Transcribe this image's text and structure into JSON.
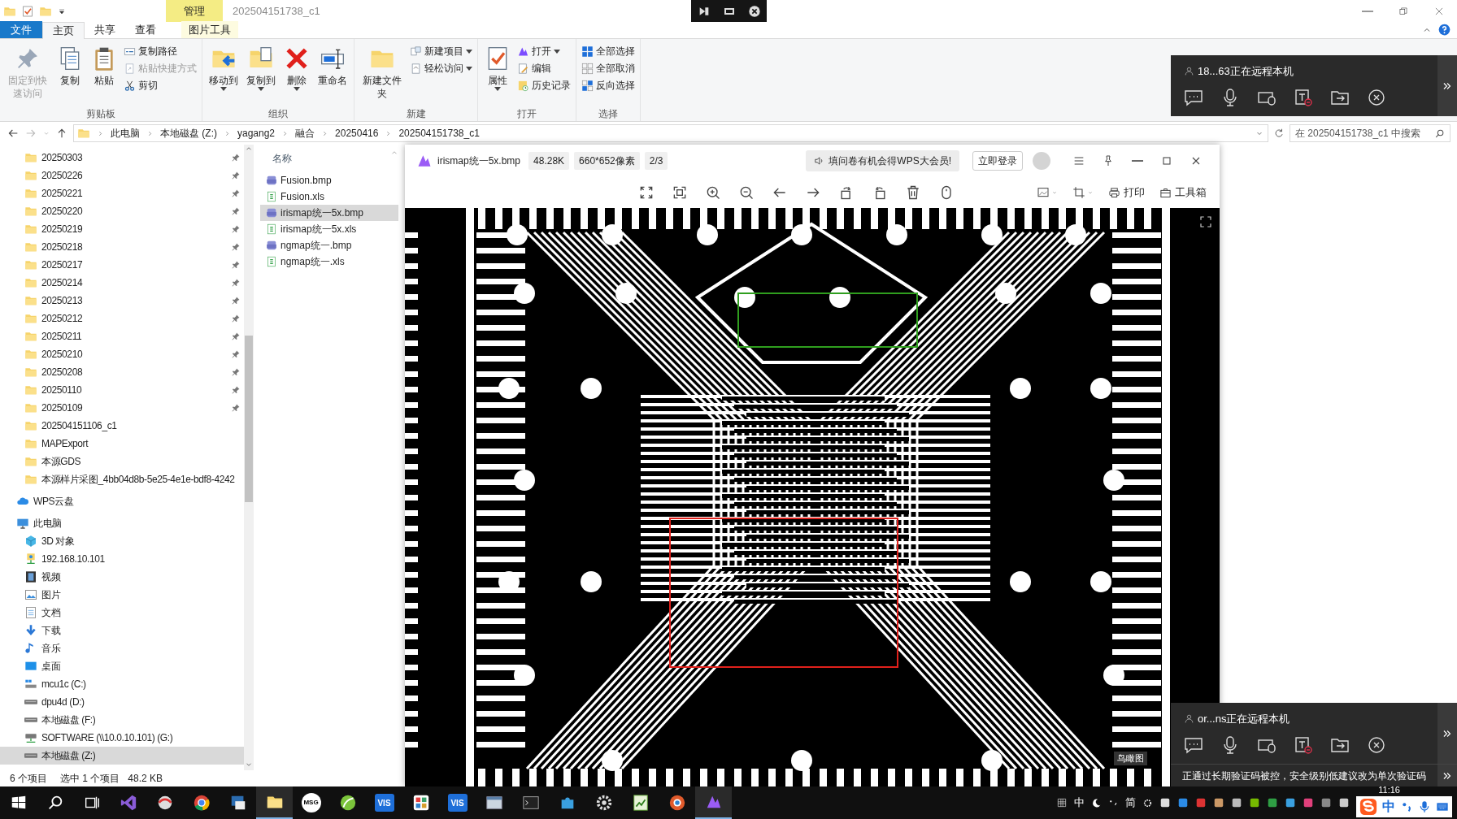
{
  "window": {
    "title": "202504151738_c1",
    "context_group": "管理"
  },
  "ribbon_tabs": [
    {
      "label": "文件",
      "kind": "file",
      "selected": false
    },
    {
      "label": "主页",
      "kind": "tab",
      "selected": true
    },
    {
      "label": "共享",
      "kind": "tab",
      "selected": false
    },
    {
      "label": "查看",
      "kind": "tab",
      "selected": false
    },
    {
      "label": "图片工具",
      "kind": "context",
      "selected": false
    }
  ],
  "ribbon_groups": [
    {
      "label": "剪贴板",
      "items": [
        {
          "kind": "large",
          "label": "固定到快速访问",
          "disabled": true,
          "dropdown": false
        },
        {
          "kind": "large",
          "label": "复制",
          "disabled": false,
          "dropdown": false
        },
        {
          "kind": "large",
          "label": "粘贴",
          "disabled": false,
          "dropdown": false
        },
        {
          "kind": "small",
          "label": "复制路径",
          "disabled": false,
          "dropdown": false
        },
        {
          "kind": "small",
          "label": "粘贴快捷方式",
          "disabled": true,
          "dropdown": false
        },
        {
          "kind": "small",
          "label": "剪切",
          "disabled": false,
          "dropdown": false
        }
      ]
    },
    {
      "label": "组织",
      "items": [
        {
          "kind": "large",
          "label": "移动到",
          "disabled": false,
          "dropdown": true
        },
        {
          "kind": "large",
          "label": "复制到",
          "disabled": false,
          "dropdown": true
        },
        {
          "kind": "large",
          "label": "删除",
          "disabled": false,
          "dropdown": true
        },
        {
          "kind": "large",
          "label": "重命名",
          "disabled": false,
          "dropdown": false
        }
      ]
    },
    {
      "label": "新建",
      "items": [
        {
          "kind": "large",
          "label": "新建文件夹",
          "disabled": false,
          "dropdown": false
        },
        {
          "kind": "small",
          "label": "新建项目",
          "disabled": false,
          "dropdown": true
        },
        {
          "kind": "small",
          "label": "轻松访问",
          "disabled": false,
          "dropdown": true
        }
      ]
    },
    {
      "label": "打开",
      "items": [
        {
          "kind": "large",
          "label": "属性",
          "disabled": false,
          "dropdown": true
        },
        {
          "kind": "small",
          "label": "打开",
          "disabled": false,
          "dropdown": true
        },
        {
          "kind": "small",
          "label": "编辑",
          "disabled": false,
          "dropdown": false
        },
        {
          "kind": "small",
          "label": "历史记录",
          "disabled": false,
          "dropdown": false
        }
      ]
    },
    {
      "label": "选择",
      "items": [
        {
          "kind": "small",
          "label": "全部选择",
          "disabled": false,
          "dropdown": false
        },
        {
          "kind": "small",
          "label": "全部取消",
          "disabled": false,
          "dropdown": false
        },
        {
          "kind": "small",
          "label": "反向选择",
          "disabled": false,
          "dropdown": false
        }
      ]
    }
  ],
  "address": {
    "path": [
      "此电脑",
      "本地磁盘 (Z:)",
      "yagang2",
      "融合",
      "20250416",
      "202504151738_c1"
    ],
    "search_placeholder": "在 202504151738_c1 中搜索"
  },
  "navigation": [
    {
      "label": "20250303",
      "kind": "folder",
      "pinned": true,
      "selected": false
    },
    {
      "label": "20250226",
      "kind": "folder",
      "pinned": true,
      "selected": false
    },
    {
      "label": "20250221",
      "kind": "folder",
      "pinned": true,
      "selected": false
    },
    {
      "label": "20250220",
      "kind": "folder",
      "pinned": true,
      "selected": false
    },
    {
      "label": "20250219",
      "kind": "folder",
      "pinned": true,
      "selected": false
    },
    {
      "label": "20250218",
      "kind": "folder",
      "pinned": true,
      "selected": false
    },
    {
      "label": "20250217",
      "kind": "folder",
      "pinned": true,
      "selected": false
    },
    {
      "label": "20250214",
      "kind": "folder",
      "pinned": true,
      "selected": false
    },
    {
      "label": "20250213",
      "kind": "folder",
      "pinned": true,
      "selected": false
    },
    {
      "label": "20250212",
      "kind": "folder",
      "pinned": true,
      "selected": false
    },
    {
      "label": "20250211",
      "kind": "folder",
      "pinned": true,
      "selected": false
    },
    {
      "label": "20250210",
      "kind": "folder",
      "pinned": true,
      "selected": false
    },
    {
      "label": "20250208",
      "kind": "folder",
      "pinned": true,
      "selected": false
    },
    {
      "label": "20250110",
      "kind": "folder",
      "pinned": true,
      "selected": false
    },
    {
      "label": "20250109",
      "kind": "folder",
      "pinned": true,
      "selected": false
    },
    {
      "label": "202504151106_c1",
      "kind": "folder",
      "pinned": false,
      "selected": false
    },
    {
      "label": "MAPExport",
      "kind": "folder",
      "pinned": false,
      "selected": false
    },
    {
      "label": "本源GDS",
      "kind": "folder",
      "pinned": false,
      "selected": false
    },
    {
      "label": "本源样片采图_4bb04d8b-5e25-4e1e-bdf8-4242",
      "kind": "folder",
      "pinned": false,
      "selected": false
    },
    {
      "label": "WPS云盘",
      "kind": "cloud",
      "pinned": false,
      "selected": false,
      "root": true
    },
    {
      "label": "此电脑",
      "kind": "pc",
      "pinned": false,
      "selected": false,
      "root": true,
      "children": [
        {
          "label": "3D 对象",
          "kind": "cube",
          "pinned": false,
          "selected": false
        },
        {
          "label": "192.168.10.101",
          "kind": "network",
          "pinned": false,
          "selected": false
        },
        {
          "label": "视频",
          "kind": "video",
          "pinned": false,
          "selected": false
        },
        {
          "label": "图片",
          "kind": "picture",
          "pinned": false,
          "selected": false
        },
        {
          "label": "文档",
          "kind": "doc",
          "pinned": false,
          "selected": false
        },
        {
          "label": "下载",
          "kind": "download",
          "pinned": false,
          "selected": false
        },
        {
          "label": "音乐",
          "kind": "music",
          "pinned": false,
          "selected": false
        },
        {
          "label": "桌面",
          "kind": "desktop",
          "pinned": false,
          "selected": false
        },
        {
          "label": "mcu1c (C:)",
          "kind": "sysdrive",
          "pinned": false,
          "selected": false
        },
        {
          "label": "dpu4d (D:)",
          "kind": "drive",
          "pinned": false,
          "selected": false
        },
        {
          "label": "本地磁盘 (F:)",
          "kind": "drive",
          "pinned": false,
          "selected": false
        },
        {
          "label": "SOFTWARE (\\\\10.0.10.101) (G:)",
          "kind": "netdrive",
          "pinned": false,
          "selected": false
        },
        {
          "label": "本地磁盘 (Z:)",
          "kind": "drive",
          "pinned": false,
          "selected": true
        }
      ]
    }
  ],
  "file_list": {
    "column": "名称",
    "files": [
      {
        "name": "Fusion.bmp",
        "kind": "bmp",
        "selected": false
      },
      {
        "name": "Fusion.xls",
        "kind": "xls",
        "selected": false
      },
      {
        "name": "irismap统一5x.bmp",
        "kind": "bmp",
        "selected": true
      },
      {
        "name": "irismap统一5x.xls",
        "kind": "xls",
        "selected": false
      },
      {
        "name": "ngmap统一.bmp",
        "kind": "bmp",
        "selected": false
      },
      {
        "name": "ngmap统一.xls",
        "kind": "xls",
        "selected": false
      }
    ]
  },
  "status_bar": {
    "count": "6 个项目",
    "selection": "选中 1 个项目",
    "size": "48.2 KB"
  },
  "image_viewer": {
    "file_name": "irismap统一5x.bmp",
    "badges": [
      "48.28K",
      "660*652像素",
      "2/3"
    ],
    "promo": "填问卷有机会得WPS大会员!",
    "login": "立即登录",
    "print": "打印",
    "toolbox": "工具箱",
    "overview_label": "鸟瞰图"
  },
  "remote_sessions": [
    {
      "user": "18...63正在远程本机"
    },
    {
      "user": "or...ns正在远程本机",
      "notice": "正通过长期验证码被控，安全级别低建议改为单次验证码"
    }
  ],
  "taskbar": {
    "apps": [
      {
        "kind": "start",
        "selected": false
      },
      {
        "kind": "search",
        "selected": false
      },
      {
        "kind": "taskview",
        "selected": false
      },
      {
        "kind": "vs",
        "selected": false
      },
      {
        "kind": "swirl",
        "selected": false
      },
      {
        "kind": "chrome",
        "selected": false
      },
      {
        "kind": "remote",
        "selected": false
      },
      {
        "kind": "explorer",
        "selected": true
      },
      {
        "kind": "msg",
        "label": "MSG",
        "selected": false
      },
      {
        "kind": "leaf",
        "selected": false
      },
      {
        "kind": "vis",
        "label": "VIS",
        "selected": false
      },
      {
        "kind": "tiles",
        "selected": false
      },
      {
        "kind": "vis",
        "label": "VIS",
        "selected": false
      },
      {
        "kind": "window",
        "selected": false
      },
      {
        "kind": "terminal",
        "selected": false
      },
      {
        "kind": "puzzle",
        "selected": false
      },
      {
        "kind": "gear",
        "selected": false
      },
      {
        "kind": "sheet",
        "selected": false
      },
      {
        "kind": "paint",
        "selected": false
      },
      {
        "kind": "viewer",
        "selected": true
      }
    ],
    "ime": [
      "中",
      "简"
    ],
    "clock": "11:16",
    "sogou_ime": "中"
  }
}
